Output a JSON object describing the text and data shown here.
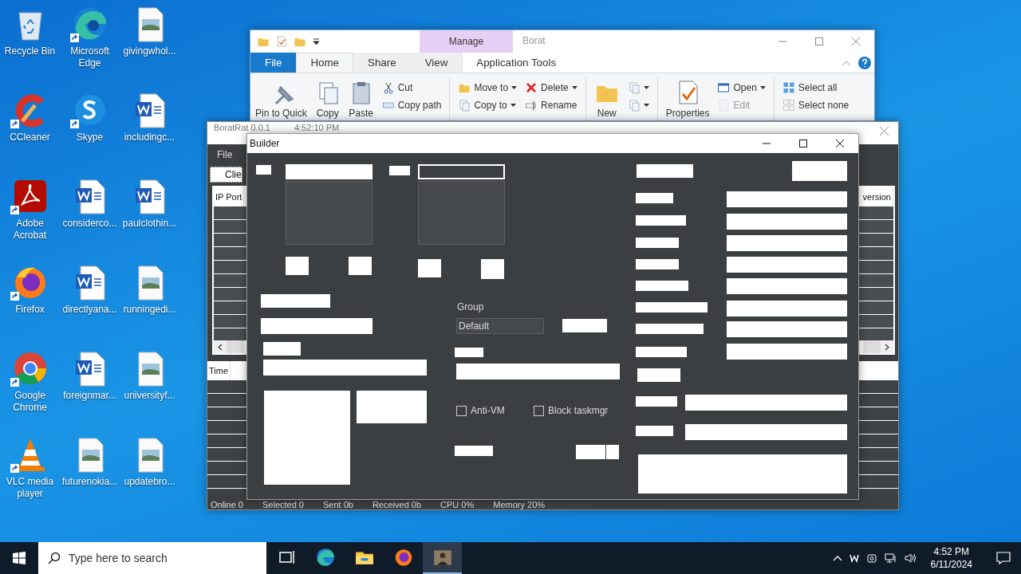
{
  "desktop": {
    "icons": [
      {
        "label": "Recycle Bin",
        "kind": "recycle",
        "shortcut": false
      },
      {
        "label": "CCleaner",
        "kind": "ccleaner",
        "shortcut": true
      },
      {
        "label": "Adobe Acrobat",
        "kind": "acrobat",
        "shortcut": true
      },
      {
        "label": "Firefox",
        "kind": "firefox",
        "shortcut": true
      },
      {
        "label": "Google Chrome",
        "kind": "chrome",
        "shortcut": true
      },
      {
        "label": "VLC media player",
        "kind": "vlc",
        "shortcut": true
      },
      {
        "label": "Microsoft Edge",
        "kind": "edge",
        "shortcut": true
      },
      {
        "label": "Skype",
        "kind": "skype",
        "shortcut": true
      },
      {
        "label": "considerco...",
        "kind": "word",
        "shortcut": false
      },
      {
        "label": "directlyana...",
        "kind": "word",
        "shortcut": false
      },
      {
        "label": "foreignmar...",
        "kind": "word",
        "shortcut": false
      },
      {
        "label": "futurenokia...",
        "kind": "image",
        "shortcut": false
      },
      {
        "label": "givingwhol...",
        "kind": "image",
        "shortcut": false
      },
      {
        "label": "includingc...",
        "kind": "word",
        "shortcut": false
      },
      {
        "label": "paulclothin...",
        "kind": "word",
        "shortcut": false
      },
      {
        "label": "runningedi...",
        "kind": "image",
        "shortcut": false
      },
      {
        "label": "universityf...",
        "kind": "image",
        "shortcut": false
      },
      {
        "label": "updatebro...",
        "kind": "image",
        "shortcut": false
      }
    ]
  },
  "explorer": {
    "title": "Borat",
    "context_tab": "Manage",
    "tabs": [
      {
        "label": "File",
        "kind": "file",
        "selected": false
      },
      {
        "label": "Home",
        "kind": "tab",
        "selected": true
      },
      {
        "label": "Share",
        "kind": "tab",
        "selected": false
      },
      {
        "label": "View",
        "kind": "tab",
        "selected": false
      },
      {
        "label": "Application Tools",
        "kind": "tab",
        "selected": false
      }
    ],
    "ribbon": [
      {
        "kind": "large",
        "items": [
          {
            "label": "Pin to Quick",
            "dropdown": false,
            "disabled": false
          }
        ]
      },
      {
        "kind": "large",
        "items": [
          {
            "label": "Copy",
            "dropdown": false,
            "disabled": false
          }
        ]
      },
      {
        "kind": "large",
        "items": [
          {
            "label": "Paste",
            "dropdown": false,
            "disabled": false
          }
        ]
      },
      {
        "kind": "small",
        "items": [
          {
            "label": "Cut",
            "dropdown": false,
            "disabled": false
          },
          {
            "label": "Copy path",
            "dropdown": false,
            "disabled": false
          }
        ]
      },
      {
        "kind": "sep"
      },
      {
        "kind": "small",
        "items": [
          {
            "label": "Move to",
            "dropdown": true,
            "disabled": false
          },
          {
            "label": "Copy to",
            "dropdown": true,
            "disabled": false
          }
        ]
      },
      {
        "kind": "small",
        "items": [
          {
            "label": "Delete",
            "dropdown": true,
            "disabled": false
          },
          {
            "label": "Rename",
            "dropdown": false,
            "disabled": false
          }
        ]
      },
      {
        "kind": "sep"
      },
      {
        "kind": "large",
        "items": [
          {
            "label": "New",
            "dropdown": false,
            "disabled": false
          }
        ]
      },
      {
        "kind": "small",
        "items": [
          {
            "dropdown": true,
            "disabled": false
          },
          {
            "dropdown": true,
            "disabled": false
          }
        ]
      },
      {
        "kind": "sep"
      },
      {
        "kind": "large",
        "items": [
          {
            "label": "Properties",
            "dropdown": false,
            "disabled": false
          }
        ]
      },
      {
        "kind": "small",
        "items": [
          {
            "label": "Open",
            "dropdown": true,
            "disabled": false
          },
          {
            "label": "Edit",
            "dropdown": false,
            "disabled": true
          }
        ]
      },
      {
        "kind": "sep"
      },
      {
        "kind": "small",
        "items": [
          {
            "label": "Select all",
            "dropdown": false,
            "disabled": false
          },
          {
            "label": "Select none",
            "dropdown": false,
            "disabled": false
          }
        ]
      }
    ]
  },
  "borat": {
    "title": "BoratRat 0.0.1",
    "time": "4:52:10 PM",
    "menu": [
      "File"
    ],
    "tab": "Clie",
    "top_columns": [
      "IP Port",
      "version"
    ],
    "bottom_column": "Time",
    "status": [
      "Online 0",
      "Selected 0",
      "Sent 0b",
      "Received 0b",
      "CPU 0%",
      "Memory 20%"
    ]
  },
  "builder": {
    "title": "Builder",
    "group_label": "Group",
    "group_value": "Default",
    "checkboxes": [
      {
        "label": "Anti-VM",
        "checked": false
      },
      {
        "label": "Block taskmgr",
        "checked": false
      }
    ]
  },
  "taskbar": {
    "search_placeholder": "Type here to search",
    "apps": [
      {
        "kind": "taskview",
        "selected": false
      },
      {
        "kind": "edge",
        "selected": false
      },
      {
        "kind": "explorer",
        "selected": false
      },
      {
        "kind": "firefox",
        "selected": false
      },
      {
        "kind": "app",
        "selected": true
      }
    ],
    "time": "4:52 PM",
    "date": "6/11/2024"
  }
}
